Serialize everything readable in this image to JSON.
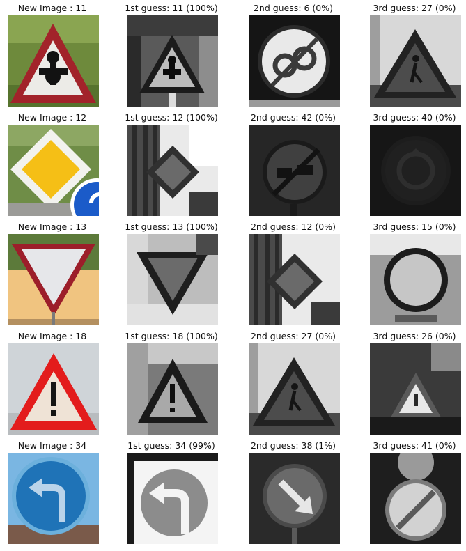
{
  "columns": [
    "New Image",
    "1st guess",
    "2nd guess",
    "3rd guess"
  ],
  "rows": [
    {
      "new_image_label": "New Image : 11",
      "guesses": [
        "1st guess: 11 (100%)",
        "2nd guess: 6 (0%)",
        "3rd guess: 27 (0%)"
      ],
      "images": [
        {
          "icon": "right-of-way-next-junction-sign-icon",
          "style": "color"
        },
        {
          "icon": "right-of-way-next-junction-sign-icon",
          "style": "grayscale"
        },
        {
          "icon": "end-of-speed-limit-sign-icon",
          "style": "grayscale"
        },
        {
          "icon": "pedestrians-warning-sign-icon",
          "style": "grayscale"
        }
      ]
    },
    {
      "new_image_label": "New Image : 12",
      "guesses": [
        "1st guess: 12 (100%)",
        "2nd guess: 42 (0%)",
        "3rd guess: 40 (0%)"
      ],
      "images": [
        {
          "icon": "priority-road-sign-icon",
          "style": "color"
        },
        {
          "icon": "priority-road-sign-icon",
          "style": "grayscale"
        },
        {
          "icon": "end-of-no-passing-sign-icon",
          "style": "grayscale"
        },
        {
          "icon": "roundabout-sign-icon",
          "style": "grayscale"
        }
      ]
    },
    {
      "new_image_label": "New Image : 13",
      "guesses": [
        "1st guess: 13 (100%)",
        "2nd guess: 12 (0%)",
        "3rd guess: 15 (0%)"
      ],
      "images": [
        {
          "icon": "yield-sign-icon",
          "style": "color"
        },
        {
          "icon": "yield-sign-icon",
          "style": "grayscale"
        },
        {
          "icon": "priority-road-sign-icon",
          "style": "grayscale"
        },
        {
          "icon": "no-vehicles-sign-icon",
          "style": "grayscale"
        }
      ]
    },
    {
      "new_image_label": "New Image : 18",
      "guesses": [
        "1st guess: 18 (100%)",
        "2nd guess: 27 (0%)",
        "3rd guess: 26 (0%)"
      ],
      "images": [
        {
          "icon": "general-caution-sign-icon",
          "style": "color"
        },
        {
          "icon": "general-caution-sign-icon",
          "style": "grayscale"
        },
        {
          "icon": "pedestrians-warning-sign-icon",
          "style": "grayscale"
        },
        {
          "icon": "traffic-signals-sign-icon",
          "style": "grayscale"
        }
      ]
    },
    {
      "new_image_label": "New Image : 34",
      "guesses": [
        "1st guess: 34 (99%)",
        "2nd guess: 38 (1%)",
        "3rd guess: 41 (0%)"
      ],
      "images": [
        {
          "icon": "turn-left-ahead-sign-icon",
          "style": "color"
        },
        {
          "icon": "turn-left-ahead-sign-icon",
          "style": "grayscale"
        },
        {
          "icon": "keep-right-sign-icon",
          "style": "grayscale"
        },
        {
          "icon": "end-of-no-passing-sign-icon",
          "style": "grayscale"
        }
      ]
    }
  ]
}
